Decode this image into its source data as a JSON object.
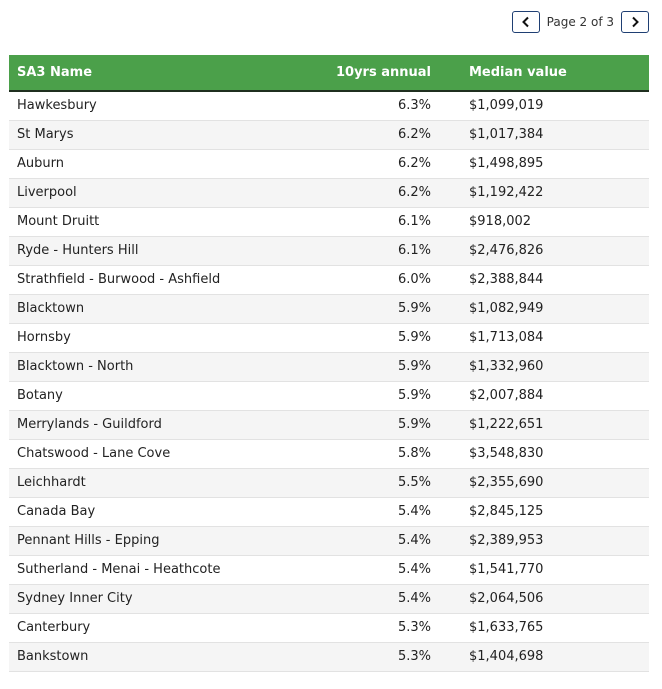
{
  "pagination": {
    "text": "Page 2 of 3",
    "prev_icon": "chevron-left-icon",
    "next_icon": "chevron-right-icon"
  },
  "table": {
    "headers": [
      "SA3 Name",
      "10yrs annual",
      "Median value"
    ],
    "rows": [
      [
        "Hawkesbury",
        "6.3%",
        "$1,099,019"
      ],
      [
        "St Marys",
        "6.2%",
        "$1,017,384"
      ],
      [
        "Auburn",
        "6.2%",
        "$1,498,895"
      ],
      [
        "Liverpool",
        "6.2%",
        "$1,192,422"
      ],
      [
        "Mount Druitt",
        "6.1%",
        "$918,002"
      ],
      [
        "Ryde - Hunters Hill",
        "6.1%",
        "$2,476,826"
      ],
      [
        "Strathfield - Burwood - Ashfield",
        "6.0%",
        "$2,388,844"
      ],
      [
        "Blacktown",
        "5.9%",
        "$1,082,949"
      ],
      [
        "Hornsby",
        "5.9%",
        "$1,713,084"
      ],
      [
        "Blacktown - North",
        "5.9%",
        "$1,332,960"
      ],
      [
        "Botany",
        "5.9%",
        "$2,007,884"
      ],
      [
        "Merrylands - Guildford",
        "5.9%",
        "$1,222,651"
      ],
      [
        "Chatswood - Lane Cove",
        "5.8%",
        "$3,548,830"
      ],
      [
        "Leichhardt",
        "5.5%",
        "$2,355,690"
      ],
      [
        "Canada Bay",
        "5.4%",
        "$2,845,125"
      ],
      [
        "Pennant Hills - Epping",
        "5.4%",
        "$2,389,953"
      ],
      [
        "Sutherland - Menai - Heathcote",
        "5.4%",
        "$1,541,770"
      ],
      [
        "Sydney Inner City",
        "5.4%",
        "$2,064,506"
      ],
      [
        "Canterbury",
        "5.3%",
        "$1,633,765"
      ],
      [
        "Bankstown",
        "5.3%",
        "$1,404,698"
      ]
    ]
  },
  "colors": {
    "header_bg": "#4ba04a",
    "header_text": "#ffffff",
    "pager_border": "#1f3f73"
  }
}
